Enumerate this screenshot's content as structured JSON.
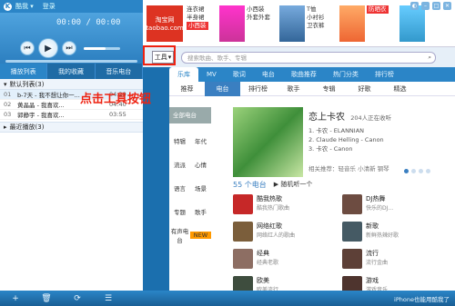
{
  "window": {
    "app_name": "酷我 ▾",
    "user": "登录"
  },
  "player": {
    "time": "00:00 / 00:00",
    "volume": 0.6,
    "progress": 0.0
  },
  "left_tabs": [
    "播放列表",
    "我的收藏",
    "音乐电台"
  ],
  "playlist": {
    "header": "默认列表(3)",
    "tracks": [
      {
        "num": "01",
        "name": "b-7天 - 我不想让你一...",
        "dur": "04:29"
      },
      {
        "num": "02",
        "name": "黄晶晶 - 我喜欢...",
        "dur": "04:40"
      },
      {
        "num": "03",
        "name": "郭静宇 - 我喜欢...",
        "dur": "03:55"
      }
    ],
    "recent_label": "最近播放(3)"
  },
  "ads": {
    "logo_text": "淘宝网 taobao.com",
    "line1": [
      "连衣裙",
      "半身裙",
      "小西装"
    ],
    "tag1": "小西装",
    "line2": [
      "小西装",
      "外套外套"
    ],
    "line3": [
      "T恤",
      "小衬衫",
      "卫衣裤"
    ],
    "tag2": "防晒衣"
  },
  "toolbar": {
    "tools_label": "工具",
    "search_placeholder": "搜索歌曲、歌手、专辑"
  },
  "callout": "点击工具按钮",
  "library_tabs": [
    "乐库",
    "MV",
    "歌词",
    "电台",
    "歌曲推荐",
    "热门分类",
    "排行榜"
  ],
  "subnav": [
    "推荐",
    "电台",
    "排行榜",
    "歌手",
    "专辑",
    "好歌",
    "精选"
  ],
  "categories": {
    "header": "全部电台",
    "rows": [
      [
        "特辑",
        "年代"
      ],
      [
        "流派",
        "心情"
      ],
      [
        "语言",
        "场景"
      ],
      [
        "专题",
        "歌手"
      ]
    ],
    "footer": "有声电台",
    "new_badge": "NEW"
  },
  "hero": {
    "title": "恋上卡农",
    "count": "204人正在收听",
    "songs": [
      "1. 卡农 - ELANNIAN",
      "2. Claude Helling - Canon",
      "3. 卡农 - Canon"
    ],
    "tags": "相关推荐：轻音乐 小清新 钢琴"
  },
  "stations_title": "55 个电台",
  "random_label": "随机听一个",
  "stations": [
    {
      "name": "酷我热歌",
      "desc": "酷我热门歌曲",
      "color": "#c62828"
    },
    {
      "name": "DJ热舞",
      "desc": "快乐的DJ...",
      "color": "#6d4c41"
    },
    {
      "name": "网络红歌",
      "desc": "网络红人的歌曲",
      "color": "#7b5e3b"
    },
    {
      "name": "新歌",
      "desc": "新鲜热辣好歌",
      "color": "#455a64"
    },
    {
      "name": "经典",
      "desc": "经典老歌",
      "color": "#8d6e63"
    },
    {
      "name": "流行",
      "desc": "流行金曲",
      "color": "#5d4037"
    },
    {
      "name": "欧美",
      "desc": "欧美流行",
      "color": "#3e4d3e"
    },
    {
      "name": "游戏",
      "desc": "游戏音乐",
      "color": "#4e342e"
    }
  ],
  "bottom": {
    "icons": [
      "+",
      "🗑",
      "⟳",
      "☰"
    ],
    "right_text": "iPhone也能用酷我了"
  }
}
